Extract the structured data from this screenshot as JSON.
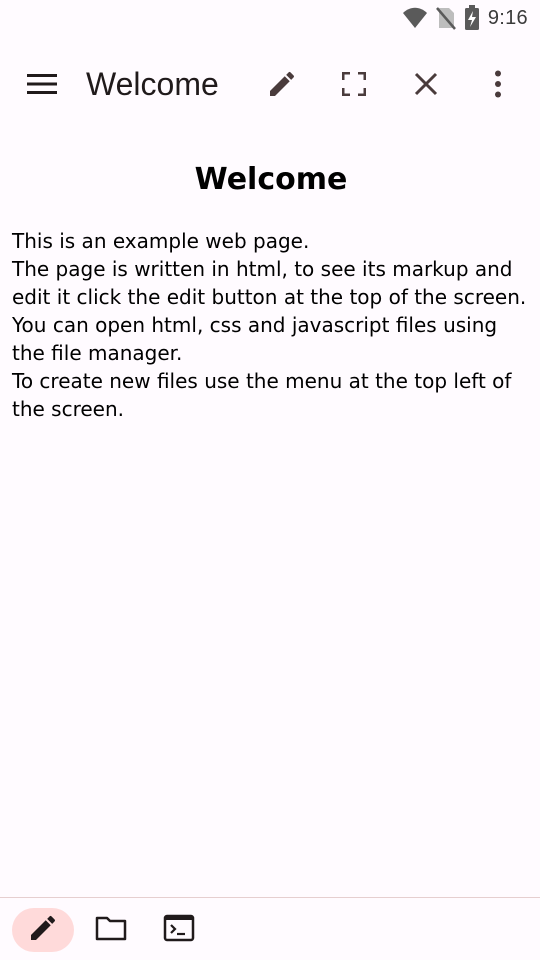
{
  "status_bar": {
    "time": "9:16",
    "icons": [
      "wifi-icon",
      "no-sim-icon",
      "battery-charging-icon"
    ]
  },
  "app_bar": {
    "title": "Welcome",
    "icons": [
      "menu-icon",
      "edit-icon",
      "fullscreen-icon",
      "close-icon",
      "more-vert-icon"
    ]
  },
  "page": {
    "heading": "Welcome",
    "lines": [
      "This is an example web page.",
      "The page is written in html, to see its markup and edit it click the edit button at the top of the screen.",
      "You can open html, css and javascript files using the file manager.",
      "To create new files use the menu at the top left of the screen."
    ]
  },
  "bottom_nav": {
    "items": [
      "edit-icon",
      "folder-icon",
      "terminal-icon"
    ],
    "active_index": 0
  },
  "colors": {
    "background": "#fffbff",
    "icon": "#4a3b3c",
    "active_pill": "#ffdada",
    "divider": "#e6cfd0"
  }
}
